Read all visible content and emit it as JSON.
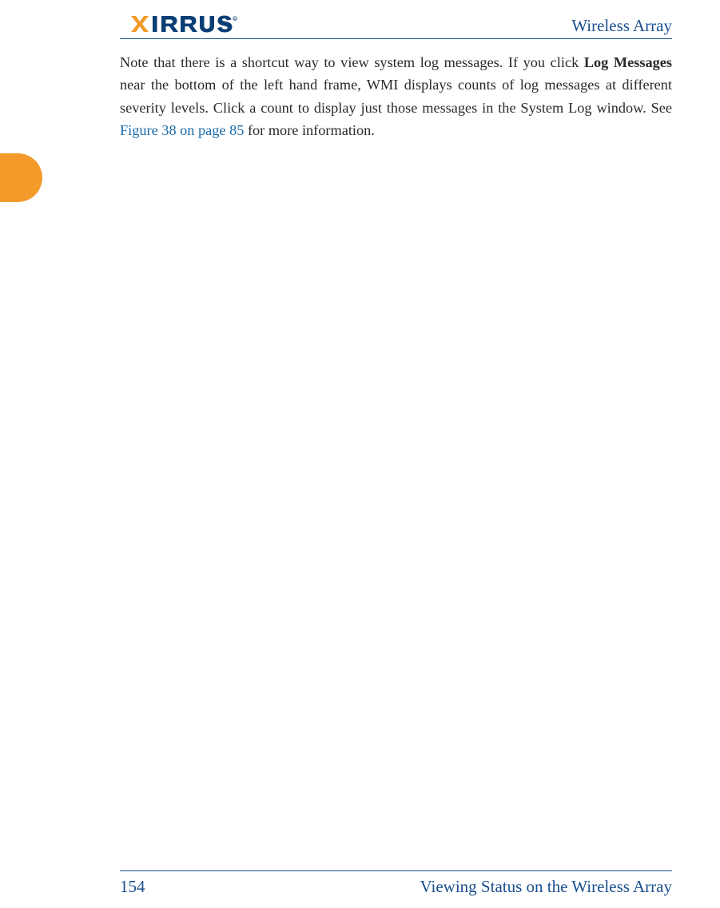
{
  "header": {
    "title": "Wireless Array",
    "logo_text": "XIRRUS",
    "logo_colors": {
      "x": "#f39a2a",
      "text": "#0a3f75"
    }
  },
  "body": {
    "p1_a": "Note that there is a shortcut way to view system log messages. If you click ",
    "p1_bold": "Log Messages",
    "p1_b": " near the bottom of the left hand frame, WMI displays counts of log messages at different severity levels. Click a count to display just those messages in the System Log window. See ",
    "p1_link": "Figure 38 on page 85",
    "p1_c": " for more information."
  },
  "footer": {
    "page_number": "154",
    "section": "Viewing Status on the Wireless Array"
  },
  "accent_color": "#f39a2a",
  "link_color": "#1a6aa8",
  "brand_color": "#1a4f8f"
}
